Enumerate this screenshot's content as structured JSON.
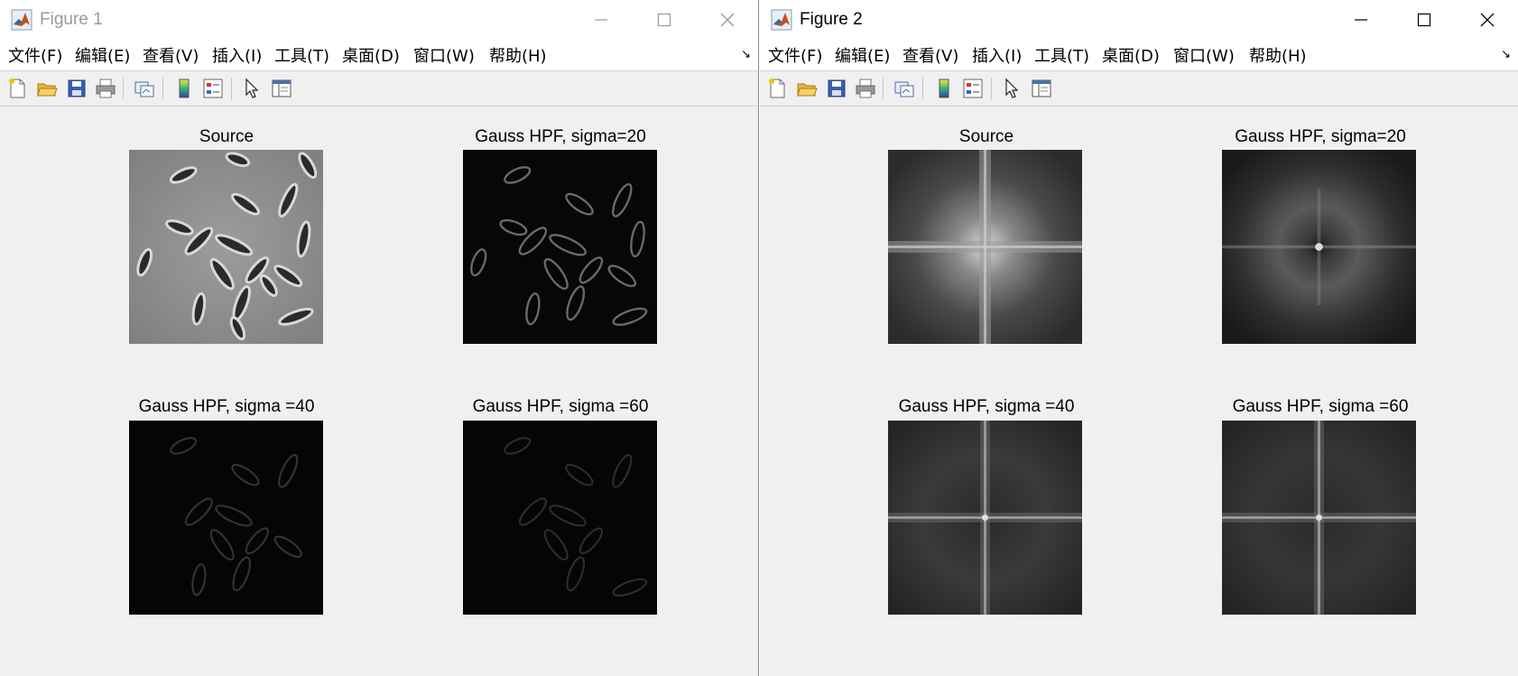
{
  "windows": [
    {
      "title": "Figure 1",
      "active": false,
      "menu": [
        "文件(F)",
        "编辑(E)",
        "查看(V)",
        "插入(I)",
        "工具(T)",
        "桌面(D)",
        "窗口(W)",
        "帮助(H)"
      ],
      "subplots": [
        {
          "title": "Source",
          "content": "bacteria-image"
        },
        {
          "title": "Gauss HPF, sigma=20",
          "content": "edge-image"
        },
        {
          "title": "Gauss HPF, sigma =40",
          "content": "edge-image-dim"
        },
        {
          "title": "Gauss HPF, sigma =60",
          "content": "edge-image-dim"
        }
      ]
    },
    {
      "title": "Figure 2",
      "active": true,
      "menu": [
        "文件(F)",
        "编辑(E)",
        "查看(V)",
        "插入(I)",
        "工具(T)",
        "桌面(D)",
        "窗口(W)",
        "帮助(H)"
      ],
      "subplots": [
        {
          "title": "Source",
          "content": "spectrum-bright-center"
        },
        {
          "title": "Gauss HPF, sigma=20",
          "content": "spectrum-ring"
        },
        {
          "title": "Gauss HPF, sigma =40",
          "content": "spectrum-cross"
        },
        {
          "title": "Gauss HPF, sigma =60",
          "content": "spectrum-cross"
        }
      ]
    }
  ],
  "toolbar_icons": [
    "new-figure-icon",
    "open-file-icon",
    "save-icon",
    "print-icon",
    "link-plot-icon",
    "colorbar-icon",
    "legend-icon",
    "edit-plot-cursor-icon",
    "property-editor-icon"
  ],
  "colors": {
    "window_bg": "#f0f0f0",
    "titlebar_bg": "#ffffff",
    "inactive_title": "#9a9a9a"
  }
}
